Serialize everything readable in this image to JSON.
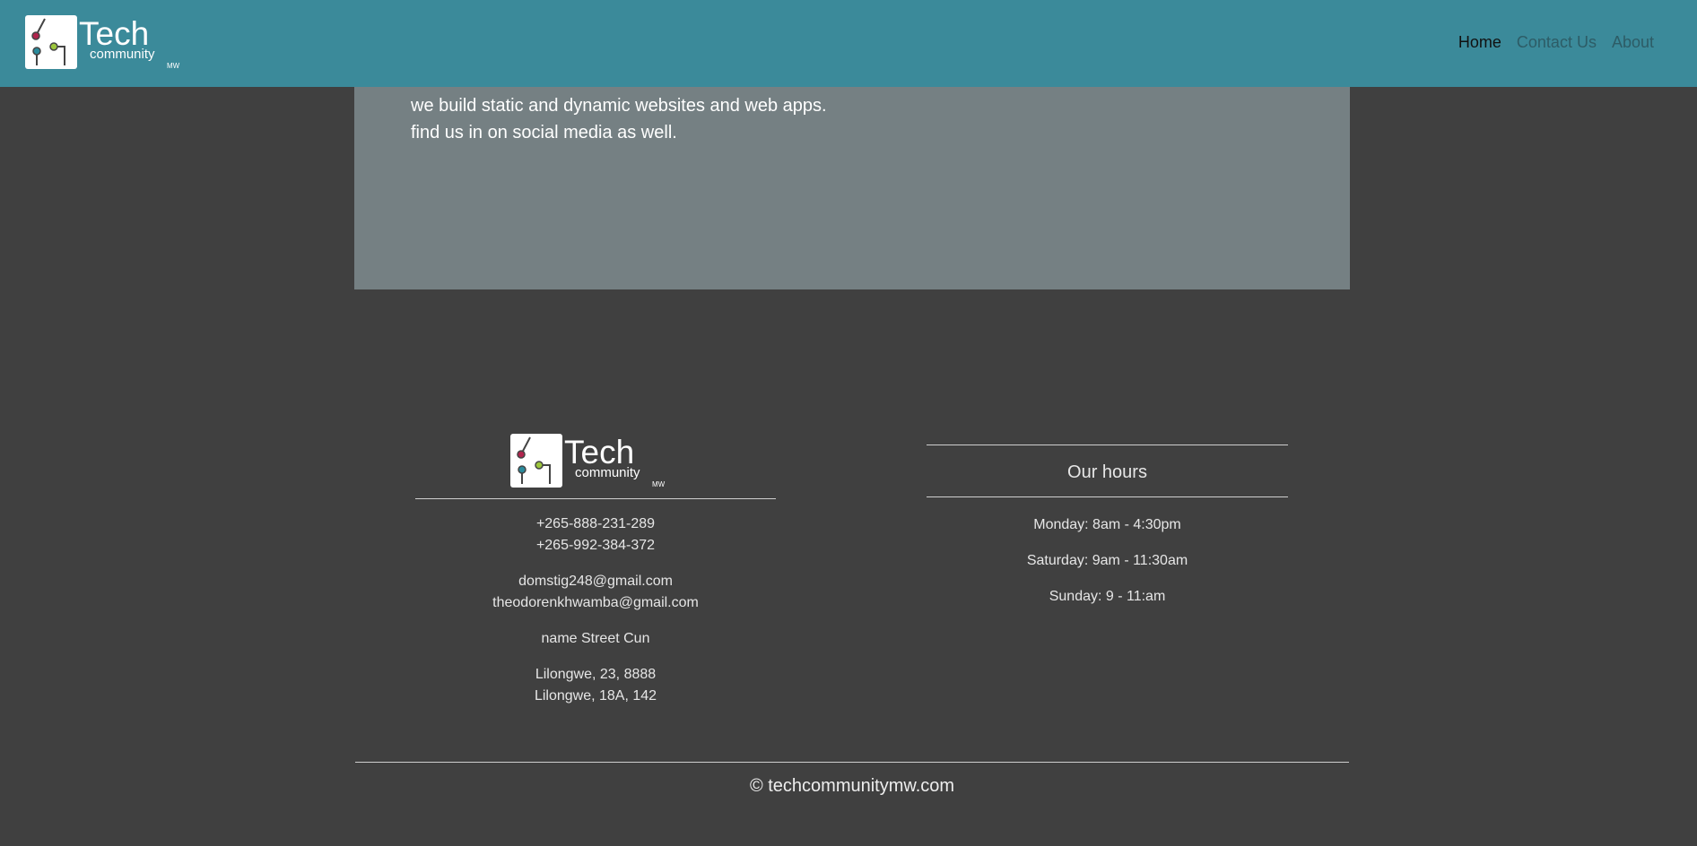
{
  "brand": {
    "word": "Tech",
    "sub": "community",
    "suffix": "MW"
  },
  "nav": {
    "links": [
      {
        "label": "Home",
        "active": true
      },
      {
        "label": "Contact Us",
        "active": false
      },
      {
        "label": "About",
        "active": false
      }
    ]
  },
  "hero": {
    "lines": [
      "we build static and dynamic websites and web apps.",
      "find us in on social media as well."
    ]
  },
  "footer": {
    "phones": [
      "+265-888-231-289",
      "+265-992-384-372"
    ],
    "emails": [
      "domstig248@gmail.com",
      "theodorenkhwamba@gmail.com"
    ],
    "street": "name Street Cun",
    "addresses": [
      "Lilongwe, 23, 8888",
      "Lilongwe, 18A, 142"
    ],
    "hours": {
      "title": "Our hours",
      "items": [
        "Monday: 8am - 4:30pm",
        "Saturday: 9am - 11:30am",
        "Sunday: 9 - 11:am"
      ]
    },
    "copyright": "© techcommunitymw.com"
  },
  "colors": {
    "navbar": "#3b8a9a",
    "hero": "#758083",
    "page": "#404040",
    "dot_red": "#b0244d",
    "dot_green": "#9cc63c",
    "dot_teal": "#2a8b9c"
  }
}
